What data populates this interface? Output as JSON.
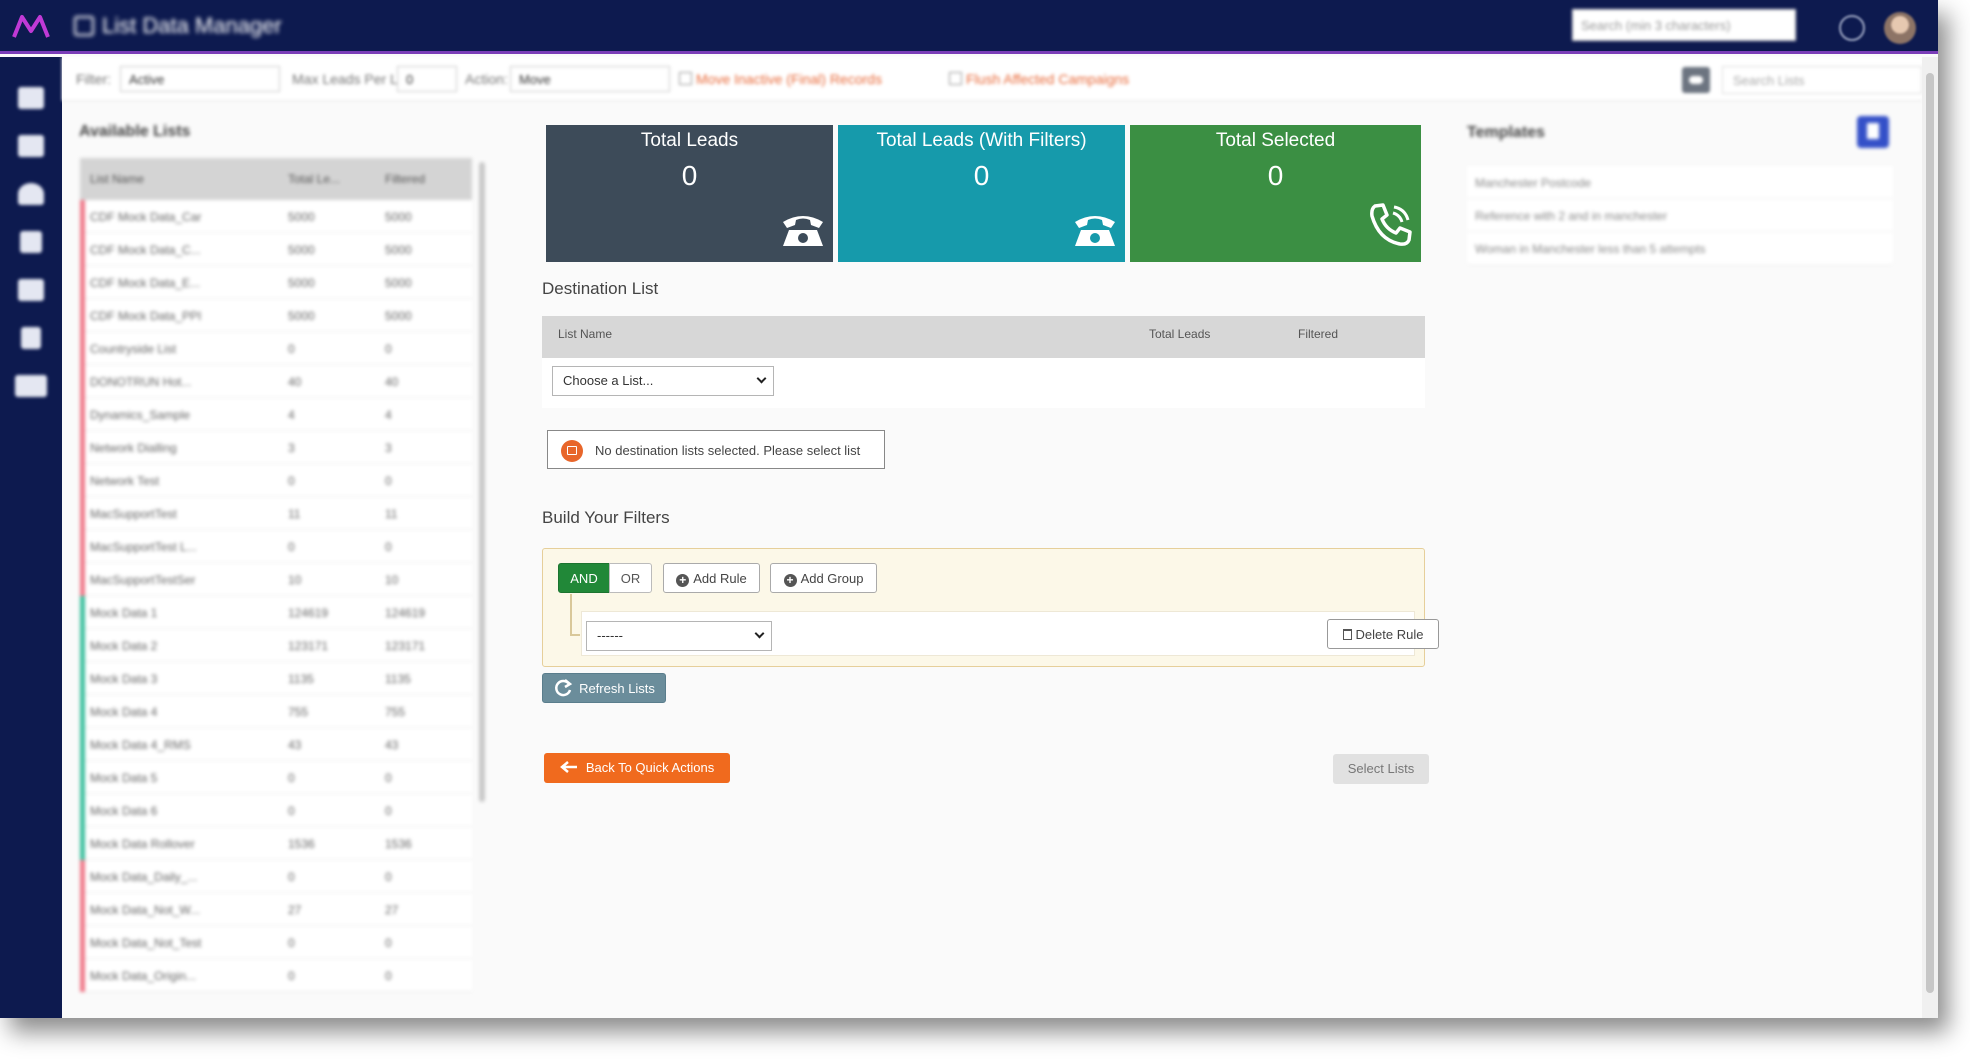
{
  "app": {
    "title": "List Data Manager"
  },
  "header": {
    "search_placeholder": "Search (min 3 characters)"
  },
  "filter_bar": {
    "filter_label": "Filter:",
    "filter_value": "Active",
    "max_leads_label": "Max Leads Per List:",
    "max_leads_value": "0",
    "action_label": "Action:",
    "action_value": "Move",
    "opt_move_inactive": "Move Inactive (Final) Records",
    "opt_flush_campaigns": "Flush Affected Campaigns",
    "search_lists_placeholder": "Search Lists"
  },
  "available_lists": {
    "title": "Available Lists",
    "columns": [
      "List Name",
      "Total Le...",
      "Filtered"
    ],
    "rows": [
      {
        "name": "CDF Mock Data_Car",
        "total": "5000",
        "filtered": "5000",
        "color": "#f07a8a"
      },
      {
        "name": "CDF Mock Data_C...",
        "total": "5000",
        "filtered": "5000",
        "color": "#f07a8a"
      },
      {
        "name": "CDF Mock Data_E...",
        "total": "5000",
        "filtered": "5000",
        "color": "#f07a8a"
      },
      {
        "name": "CDF Mock Data_PPI",
        "total": "5000",
        "filtered": "5000",
        "color": "#f07a8a"
      },
      {
        "name": "Countryside List",
        "total": "0",
        "filtered": "0",
        "color": "#f07a8a"
      },
      {
        "name": "DONOTRUN Hot...",
        "total": "40",
        "filtered": "40",
        "color": "#f07a8a"
      },
      {
        "name": "Dynamics_Sample",
        "total": "4",
        "filtered": "4",
        "color": "#f07a8a"
      },
      {
        "name": "Network Dialling",
        "total": "3",
        "filtered": "3",
        "color": "#f07a8a"
      },
      {
        "name": "Network Test",
        "total": "0",
        "filtered": "0",
        "color": "#f07a8a"
      },
      {
        "name": "MacSupportTest",
        "total": "11",
        "filtered": "11",
        "color": "#f07a8a"
      },
      {
        "name": "MacSupportTest L...",
        "total": "0",
        "filtered": "0",
        "color": "#f07a8a"
      },
      {
        "name": "MacSupportTestSer",
        "total": "10",
        "filtered": "10",
        "color": "#f07a8a"
      },
      {
        "name": "Mock Data 1",
        "total": "124619",
        "filtered": "124619",
        "color": "#3fc1a0"
      },
      {
        "name": "Mock Data 2",
        "total": "123171",
        "filtered": "123171",
        "color": "#3fc1a0"
      },
      {
        "name": "Mock Data 3",
        "total": "1135",
        "filtered": "1135",
        "color": "#3fc1a0"
      },
      {
        "name": "Mock Data 4",
        "total": "755",
        "filtered": "755",
        "color": "#3fc1a0"
      },
      {
        "name": "Mock Data 4_RMS",
        "total": "43",
        "filtered": "43",
        "color": "#3fc1a0"
      },
      {
        "name": "Mock Data 5",
        "total": "0",
        "filtered": "0",
        "color": "#3fc1a0"
      },
      {
        "name": "Mock Data 6",
        "total": "0",
        "filtered": "0",
        "color": "#3fc1a0"
      },
      {
        "name": "Mock Data Rollover",
        "total": "1536",
        "filtered": "1536",
        "color": "#3fc1a0"
      },
      {
        "name": "Mock Data_Daily_...",
        "total": "0",
        "filtered": "0",
        "color": "#f07a8a"
      },
      {
        "name": "Mock Data_Not_W...",
        "total": "27",
        "filtered": "27",
        "color": "#f07a8a"
      },
      {
        "name": "Mock Data_Not_Test",
        "total": "0",
        "filtered": "0",
        "color": "#f07a8a"
      },
      {
        "name": "Mock Data_Origin...",
        "total": "0",
        "filtered": "0",
        "color": "#f07a8a"
      }
    ]
  },
  "cards": {
    "total_leads": {
      "title": "Total Leads",
      "value": "0"
    },
    "total_filtered": {
      "title": "Total Leads (With Filters)",
      "value": "0"
    },
    "total_selected": {
      "title": "Total Selected",
      "value": "0"
    }
  },
  "destination": {
    "title": "Destination List",
    "col_name": "List Name",
    "col_total": "Total Leads",
    "col_filtered": "Filtered",
    "select_value": "Choose a List...",
    "alert": "No destination lists selected. Please select list"
  },
  "filters": {
    "title": "Build Your Filters",
    "and_label": "AND",
    "or_label": "OR",
    "add_rule": "Add Rule",
    "add_group": "Add Group",
    "rule_field_value": "------",
    "delete_rule": "Delete Rule"
  },
  "actions": {
    "refresh": "Refresh Lists",
    "back": "Back To Quick Actions",
    "select_lists": "Select Lists"
  },
  "templates": {
    "title": "Templates",
    "items": [
      "Manchester Postcode",
      "Reference with 2 and in manchester",
      "Woman in Manchester less than 5 attempts"
    ]
  },
  "colors": {
    "nav": "#0d1a4f",
    "card_total": "#3d4b59",
    "card_filtered": "#169aab",
    "card_selected": "#3b8f43",
    "and_active": "#218838",
    "back_button": "#f06a1e"
  }
}
